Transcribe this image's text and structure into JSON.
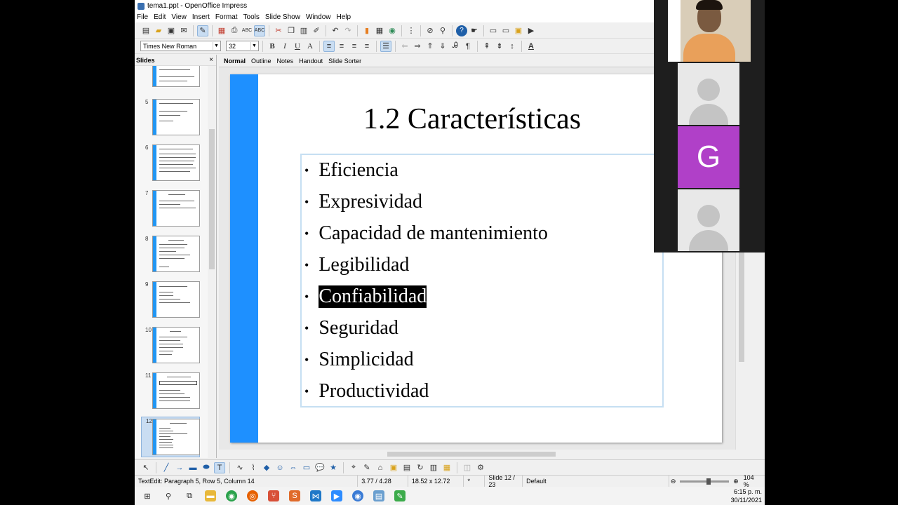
{
  "window": {
    "title": "tema1.ppt - OpenOffice Impress"
  },
  "menu": [
    "File",
    "Edit",
    "View",
    "Insert",
    "Format",
    "Tools",
    "Slide Show",
    "Window",
    "Help"
  ],
  "format_bar": {
    "font_name": "Times New Roman",
    "font_size": "32"
  },
  "slides_pane": {
    "title": "Slides",
    "close_glyph": "×",
    "thumbnails": [
      {
        "number": "5"
      },
      {
        "number": "6"
      },
      {
        "number": "7"
      },
      {
        "number": "8"
      },
      {
        "number": "9"
      },
      {
        "number": "10"
      },
      {
        "number": "11"
      },
      {
        "number": "12"
      }
    ]
  },
  "view_tabs": [
    "Normal",
    "Outline",
    "Notes",
    "Handout",
    "Slide Sorter"
  ],
  "slide": {
    "title": "1.2 Características",
    "bullets": [
      "Eficiencia",
      "Expresividad",
      "Capacidad de mantenimiento",
      "Legibilidad",
      "Confiabilidad",
      "Seguridad",
      "Simplicidad",
      "Productividad"
    ],
    "selected_bullet_index": 4,
    "accent_color": "#1e90ff"
  },
  "status": {
    "edit_info": "TextEdit: Paragraph 5, Row 5, Column 14",
    "position": "3.77 / 4.28",
    "size": "18.52 x 12.72",
    "marker": "*",
    "slide_info": "Slide 12 / 23",
    "layout": "Default",
    "zoom": "104 %"
  },
  "clock": {
    "time": "6:15 p. m.",
    "date": "30/11/2021"
  },
  "video": {
    "participant_initial": "G",
    "participant_color": "#b040c8"
  }
}
